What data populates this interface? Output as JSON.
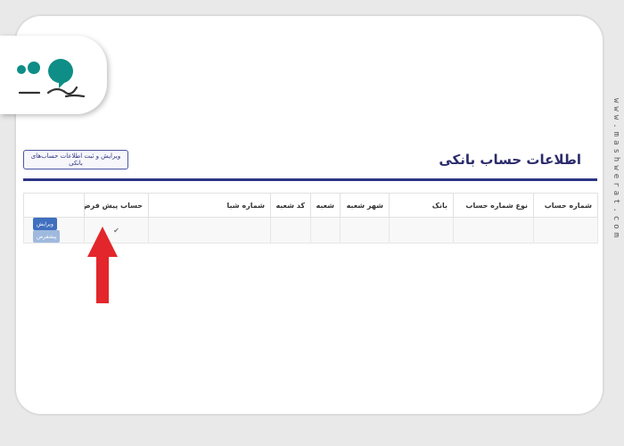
{
  "page": {
    "title": "اطلاعات حساب بانکی",
    "edit_register_button": "ویرایش و ثبت اطلاعات حساب‌های بانکی"
  },
  "table": {
    "headers": {
      "account_number": "شماره حساب",
      "account_type": "نوع شماره حساب",
      "bank": "بانک",
      "branch_city": "شهر شعبه",
      "branch": "شعبه",
      "branch_code": "کد شعبه",
      "sheba": "شماره شبا",
      "default_account": "حساب پیش فرض"
    },
    "row": {
      "default_check": "✔",
      "edit_button": "ویرایش",
      "default_button": "پیشفرض"
    }
  },
  "watermark": "www.mashwerat.com",
  "colors": {
    "accent": "#2c3585",
    "title": "#2b2b6b",
    "edit_button": "#3f6fbf",
    "default_button": "#9fb9de",
    "arrow": "#e3262b",
    "logo_teal": "#0e8e86"
  },
  "icons": {
    "logo": "mashwerat-logo-icon",
    "check": "check-icon",
    "arrow": "red-arrow-up-icon"
  }
}
